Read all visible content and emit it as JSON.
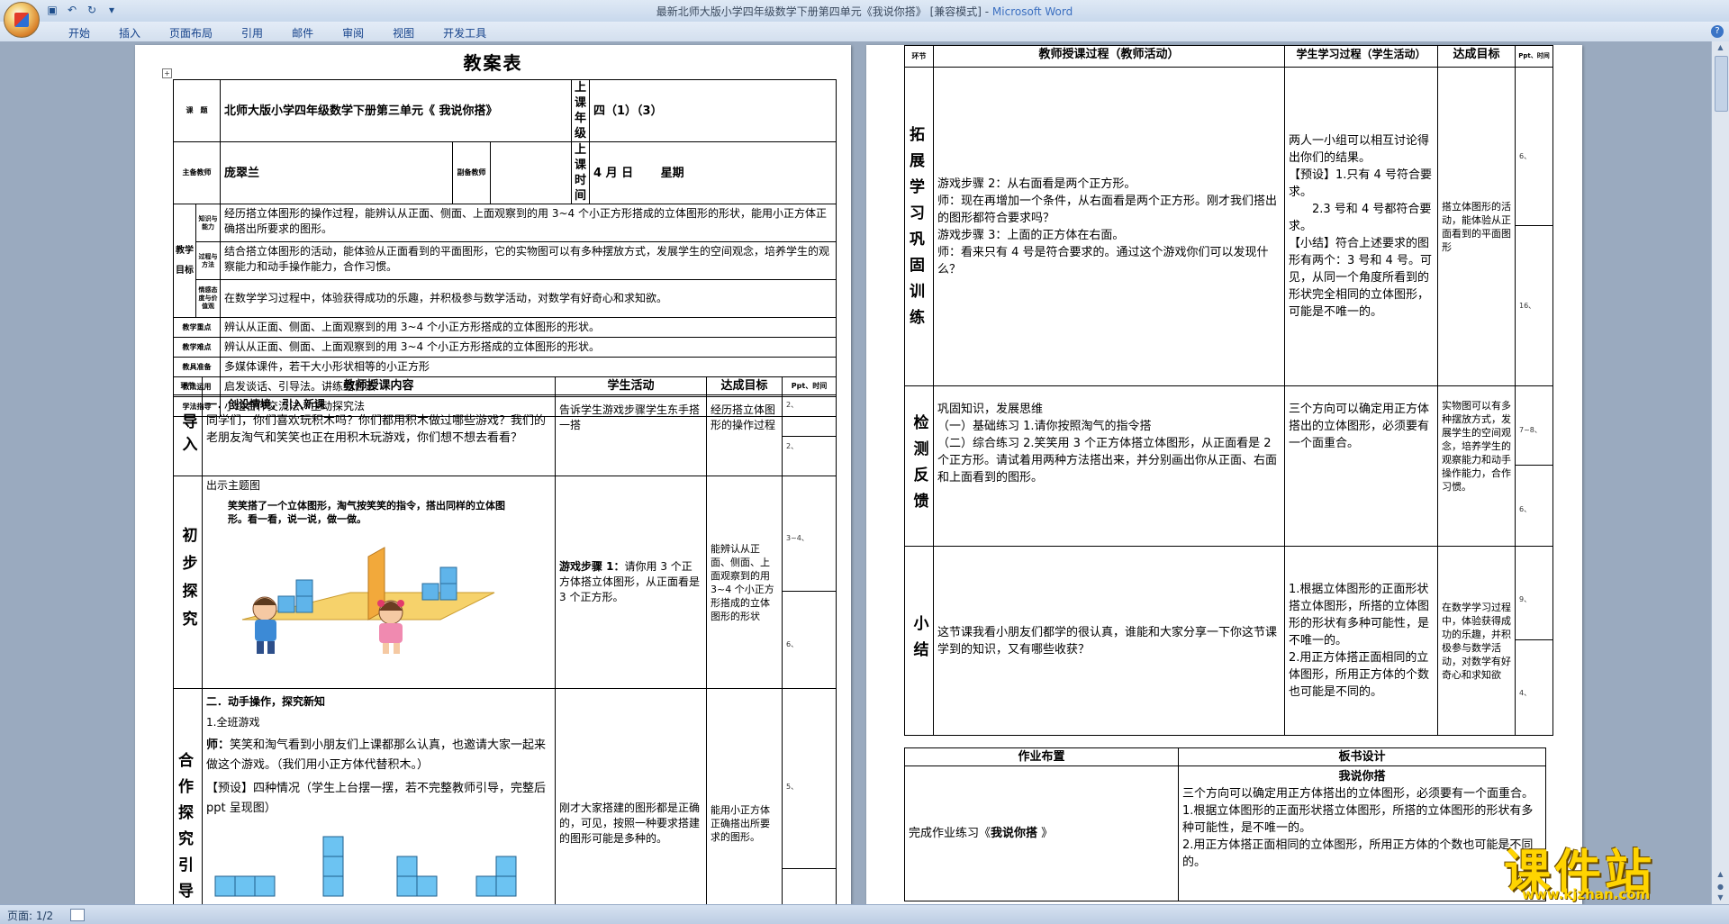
{
  "window": {
    "title_prefix": "最新北师大版小学四年级数学下册第四单元《我说你搭》 [兼容模式] - ",
    "app_name": "Microsoft Word"
  },
  "ribbon": {
    "tabs": [
      "开始",
      "插入",
      "页面布局",
      "引用",
      "邮件",
      "审阅",
      "视图",
      "开发工具"
    ]
  },
  "status": {
    "page": "页面: 1/2"
  },
  "page1": {
    "doc_title": "教案表",
    "info": {
      "topic_label": "课　题",
      "topic_value": "北师大版小学四年级数学下册第三单元《 我说你搭》",
      "grade_label": "上课年级",
      "grade_value": "四（1）（3）",
      "main_teacher_label": "主备教师",
      "main_teacher_value": "庞翠兰",
      "sub_teacher_label": "副备教师",
      "time_label": "上课时间",
      "time_value": "4 月 日　　 星期"
    },
    "goals": {
      "group_label": "教学目标",
      "g1_label": "知识与能力",
      "g1_text": "经历搭立体图形的操作过程，能辨认从正面、侧面、上面观察到的用 3~4 个小正方形搭成的立体图形的形状，能用小正方体正确搭出所要求的图形。",
      "g2_label": "过程与方法",
      "g2_text": "结合搭立体图形的活动，能体验从正面看到的平面图形，它的实物图可以有多种摆放方式，发展学生的空间观念，培养学生的观察能力和动手操作能力，合作习惯。",
      "g3_label": "情感态度与价值观",
      "g3_text": "在数学学习过程中，体验获得成功的乐趣，并积极参与数学活动，对数学有好奇心和求知欲。"
    },
    "rows": {
      "key_label": "教学重点",
      "key_text": "辨认从正面、侧面、上面观察到的用 3~4 个小正方形搭成的立体图形的形状。",
      "diff_label": "教学难点",
      "diff_text": "辨认从正面、侧面、上面观察到的用 3~4 个小正方形搭成的立体图形的形状。",
      "prep_label": "教具准备",
      "prep_text": "多媒体课件，若干大小形状相等的小正方形",
      "method_label": "教法运用",
      "method_text": "启发谈话、引导法。讲练结合法",
      "study_label": "学法指导",
      "study_text": "小组合作交流法、主动探究法"
    },
    "table_head": {
      "stage": "环节",
      "content": "教师授课内容",
      "activity": "学生活动",
      "target": "达成目标",
      "time": "Ppt、时间"
    },
    "s1": {
      "stage": "导入",
      "title": "一．创设情境，引入新课",
      "text": "同学们，你们喜欢玩积木吗？你们都用积木做过哪些游戏？我们的老朋友淘气和笑笑也正在用积木玩游戏，你们想不想去看看？",
      "activity": "告诉学生游戏步骤学生东手搭一搭",
      "target": "经历搭立体图形的操作过程",
      "t1": "2、",
      "t2": "2、"
    },
    "s2": {
      "stage": "初步探究",
      "intro": "出示主题图",
      "caption": "笑笑搭了一个立体图形，淘气按笑笑的指令，搭出同样的立体图形。看一看，说一说，做一做。",
      "activity_bold": "游戏步骤 1：",
      "activity_text": "请你用 3 个正方体搭立体图形，从正面看是 3 个正方形。",
      "target": "能辨认从正面、侧面、上面观察到的用 3~4 个小正方形搭成的立体图形的形状",
      "t1": "3~4、",
      "t2": "6、"
    },
    "s3": {
      "stage": "合作探究引导",
      "title": "二．动手操作，探究新知",
      "l1": "1.全班游戏",
      "l2_bold": "师：",
      "l2": "笑笑和淘气看到小朋友们上课都那么认真，也邀请大家一起来做这个游戏。（我们用小正方体代替积木。）",
      "l3": "【预设】四种情况（学生上台摆一摆，若不完整教师引导，完整后 ppt 呈现图）",
      "activity": "刚才大家搭建的图形都是正确的，可见，按照一种要求搭建的图形可能是多种的。",
      "target": "能用小正方体正确搭出所要求的图形。",
      "t1": "5、"
    }
  },
  "page2": {
    "head": {
      "stage": "环节",
      "process": "教师授课过程（教师活动）",
      "student": "学生学习过程（学生活动）",
      "target": "达成目标",
      "time": "Ppt、时间"
    },
    "s4": {
      "stage": "拓展学习巩固训练",
      "lines": [
        "游戏步骤 2：从右面看是两个正方形。",
        "师：现在再增加一个条件，从右面看是两个正方形。刚才我们搭出的图形都符合要求吗？",
        "游戏步骤 3：上面的正方体在右面。",
        "师：看来只有 4 号是符合要求的。通过这个游戏你们可以发现什么？"
      ],
      "student": [
        "两人一小组可以相互讨论得出你们的结果。",
        "【预设】1.只有 4 号符合要求。",
        "　　2.3 号和 4 号都符合要求。",
        "【小结】符合上述要求的图形有两个：3 号和 4 号。可见，从同一个角度所看到的形状完全相同的立体图形，可能是不唯一的。"
      ],
      "target": "搭立体图形的活动，能体验从正面看到的平面图形",
      "t1": "6、",
      "t2": "16、"
    },
    "s5": {
      "stage": "检测反馈",
      "lines": [
        "巩固知识，发展思维",
        "（一）基础练习 1.请你按照淘气的指令搭",
        "（二）综合练习 2.笑笑用 3 个正方体搭立体图形，从正面看是 2 个正方形。请试着用两种方法搭出来，并分别画出你从正面、右面和上面看到的图形。"
      ],
      "student": "三个方向可以确定用正方体搭出的立体图形，必须要有一个面重合。",
      "target": "实物图可以有多种摆放方式，发展学生的空间观念，培养学生的观察能力和动手操作能力，合作习惯。",
      "t1": "7~8、",
      "t2": "6、"
    },
    "s6": {
      "stage": "小结",
      "text": "这节课我看小朋友们都学的很认真，谁能和大家分享一下你这节课学到的知识，又有哪些收获？",
      "student": [
        "1.根据立体图形的正面形状搭立体图形，所搭的立体图形的形状有多种可能性，是不唯一的。",
        "2.用正方体搭正面相同的立体图形，所用正方体的个数也可能是不同的。"
      ],
      "target": "在数学学习过程中，体验获得成功的乐趣，并积极参与数学活动，对数学有好奇心和求知欲",
      "t1": "9、",
      "t2": "4、"
    },
    "bottom": {
      "hw_label": "作业布置",
      "board_label": "板书设计",
      "hw_prefix": "完成作业练习《",
      "hw_bold": "我说你搭",
      "hw_suffix": " 》",
      "board_title": "我说你搭",
      "board_lines": [
        "三个方向可以确定用正方体搭出的立体图形，必须要有一个面重合。",
        "1.根据立体图形的正面形状搭立体图形，所搭的立体图形的形状有多种可能性，是不唯一的。",
        "2.用正方体搭正面相同的立体图形，所用正方体的个数也可能是不同的。"
      ]
    }
  },
  "watermark": {
    "title": "课件站",
    "url": "www.kjzhan.com"
  }
}
